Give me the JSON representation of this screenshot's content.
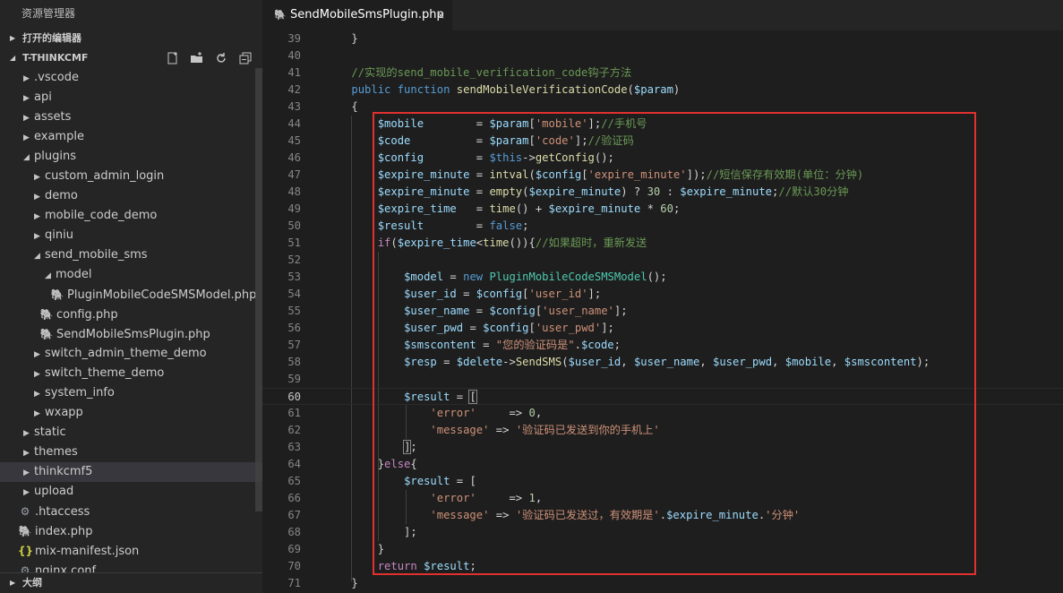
{
  "explorer": {
    "title": "资源管理器",
    "open_editors": "打开的编辑器",
    "project": "T-THINKCMF",
    "outline": "大纲",
    "tree": [
      {
        "label": ".vscode",
        "depth": 0,
        "kind": "folder",
        "expanded": false
      },
      {
        "label": "api",
        "depth": 0,
        "kind": "folder",
        "expanded": false
      },
      {
        "label": "assets",
        "depth": 0,
        "kind": "folder",
        "expanded": false
      },
      {
        "label": "example",
        "depth": 0,
        "kind": "folder",
        "expanded": false
      },
      {
        "label": "plugins",
        "depth": 0,
        "kind": "folder",
        "expanded": true
      },
      {
        "label": "custom_admin_login",
        "depth": 1,
        "kind": "folder",
        "expanded": false
      },
      {
        "label": "demo",
        "depth": 1,
        "kind": "folder",
        "expanded": false
      },
      {
        "label": "mobile_code_demo",
        "depth": 1,
        "kind": "folder",
        "expanded": false
      },
      {
        "label": "qiniu",
        "depth": 1,
        "kind": "folder",
        "expanded": false
      },
      {
        "label": "send_mobile_sms",
        "depth": 1,
        "kind": "folder",
        "expanded": true
      },
      {
        "label": "model",
        "depth": 2,
        "kind": "folder",
        "expanded": true
      },
      {
        "label": "PluginMobileCodeSMSModel.php",
        "depth": 3,
        "kind": "php"
      },
      {
        "label": "config.php",
        "depth": 2,
        "kind": "php"
      },
      {
        "label": "SendMobileSmsPlugin.php",
        "depth": 2,
        "kind": "php"
      },
      {
        "label": "switch_admin_theme_demo",
        "depth": 1,
        "kind": "folder",
        "expanded": false
      },
      {
        "label": "switch_theme_demo",
        "depth": 1,
        "kind": "folder",
        "expanded": false
      },
      {
        "label": "system_info",
        "depth": 1,
        "kind": "folder",
        "expanded": false
      },
      {
        "label": "wxapp",
        "depth": 1,
        "kind": "folder",
        "expanded": false
      },
      {
        "label": "static",
        "depth": 0,
        "kind": "folder",
        "expanded": false
      },
      {
        "label": "themes",
        "depth": 0,
        "kind": "folder",
        "expanded": false
      },
      {
        "label": "thinkcmf5",
        "depth": 0,
        "kind": "folder",
        "expanded": false,
        "selected": true
      },
      {
        "label": "upload",
        "depth": 0,
        "kind": "folder",
        "expanded": false
      },
      {
        "label": ".htaccess",
        "depth": 0,
        "kind": "gear"
      },
      {
        "label": "index.php",
        "depth": 0,
        "kind": "php"
      },
      {
        "label": "mix-manifest.json",
        "depth": 0,
        "kind": "json"
      },
      {
        "label": "nginx.conf",
        "depth": 0,
        "kind": "gear"
      }
    ]
  },
  "tab": {
    "label": "SendMobileSmsPlugin.php",
    "close": "×"
  },
  "editor": {
    "current_line": 60,
    "lines": [
      {
        "n": "39",
        "t": [
          [
            "p",
            "    }"
          ]
        ]
      },
      {
        "n": "40",
        "t": []
      },
      {
        "n": "41",
        "t": [
          [
            "p",
            "    "
          ],
          [
            "com",
            "//实现的send_mobile_verification_code钩子方法"
          ]
        ]
      },
      {
        "n": "42",
        "t": [
          [
            "p",
            "    "
          ],
          [
            "kw",
            "public function "
          ],
          [
            "fn",
            "sendMobileVerificationCode"
          ],
          [
            "p",
            "("
          ],
          [
            "var",
            "$param"
          ],
          [
            "p",
            ")"
          ]
        ]
      },
      {
        "n": "43",
        "t": [
          [
            "p",
            "    {"
          ]
        ]
      },
      {
        "n": "44",
        "t": [
          [
            "p",
            "        "
          ],
          [
            "var",
            "$mobile"
          ],
          [
            "p",
            "        = "
          ],
          [
            "var",
            "$param"
          ],
          [
            "p",
            "["
          ],
          [
            "str",
            "'mobile'"
          ],
          [
            "p",
            "];"
          ],
          [
            "com",
            "//手机号"
          ]
        ]
      },
      {
        "n": "45",
        "t": [
          [
            "p",
            "        "
          ],
          [
            "var",
            "$code"
          ],
          [
            "p",
            "          = "
          ],
          [
            "var",
            "$param"
          ],
          [
            "p",
            "["
          ],
          [
            "str",
            "'code'"
          ],
          [
            "p",
            "];"
          ],
          [
            "com",
            "//验证码"
          ]
        ]
      },
      {
        "n": "46",
        "t": [
          [
            "p",
            "        "
          ],
          [
            "var",
            "$config"
          ],
          [
            "p",
            "        = "
          ],
          [
            "kw",
            "$this"
          ],
          [
            "p",
            "->"
          ],
          [
            "fn",
            "getConfig"
          ],
          [
            "p",
            "();"
          ]
        ]
      },
      {
        "n": "47",
        "t": [
          [
            "p",
            "        "
          ],
          [
            "var",
            "$expire_minute"
          ],
          [
            "p",
            " = "
          ],
          [
            "fn",
            "intval"
          ],
          [
            "p",
            "("
          ],
          [
            "var",
            "$config"
          ],
          [
            "p",
            "["
          ],
          [
            "str",
            "'expire_minute'"
          ],
          [
            "p",
            "]);"
          ],
          [
            "com",
            "//短信保存有效期(单位：分钟)"
          ]
        ]
      },
      {
        "n": "48",
        "t": [
          [
            "p",
            "        "
          ],
          [
            "var",
            "$expire_minute"
          ],
          [
            "p",
            " = "
          ],
          [
            "fn",
            "empty"
          ],
          [
            "p",
            "("
          ],
          [
            "var",
            "$expire_minute"
          ],
          [
            "p",
            ") ? "
          ],
          [
            "num",
            "30"
          ],
          [
            "p",
            " : "
          ],
          [
            "var",
            "$expire_minute"
          ],
          [
            "p",
            ";"
          ],
          [
            "com",
            "//默认30分钟"
          ]
        ]
      },
      {
        "n": "49",
        "t": [
          [
            "p",
            "        "
          ],
          [
            "var",
            "$expire_time"
          ],
          [
            "p",
            "   = "
          ],
          [
            "fn",
            "time"
          ],
          [
            "p",
            "() + "
          ],
          [
            "var",
            "$expire_minute"
          ],
          [
            "p",
            " * "
          ],
          [
            "num",
            "60"
          ],
          [
            "p",
            ";"
          ]
        ]
      },
      {
        "n": "50",
        "t": [
          [
            "p",
            "        "
          ],
          [
            "var",
            "$result"
          ],
          [
            "p",
            "        = "
          ],
          [
            "kw",
            "false"
          ],
          [
            "p",
            ";"
          ]
        ]
      },
      {
        "n": "51",
        "t": [
          [
            "p",
            "        "
          ],
          [
            "ctl",
            "if"
          ],
          [
            "p",
            "("
          ],
          [
            "var",
            "$expire_time"
          ],
          [
            "p",
            "<"
          ],
          [
            "fn",
            "time"
          ],
          [
            "p",
            "()){"
          ],
          [
            "com",
            "//如果超时，重新发送"
          ]
        ]
      },
      {
        "n": "52",
        "t": []
      },
      {
        "n": "53",
        "t": [
          [
            "p",
            "            "
          ],
          [
            "var",
            "$model"
          ],
          [
            "p",
            " = "
          ],
          [
            "kw",
            "new "
          ],
          [
            "cls",
            "PluginMobileCodeSMSModel"
          ],
          [
            "p",
            "();"
          ]
        ]
      },
      {
        "n": "54",
        "t": [
          [
            "p",
            "            "
          ],
          [
            "var",
            "$user_id"
          ],
          [
            "p",
            " = "
          ],
          [
            "var",
            "$config"
          ],
          [
            "p",
            "["
          ],
          [
            "str",
            "'user_id'"
          ],
          [
            "p",
            "];"
          ]
        ]
      },
      {
        "n": "55",
        "t": [
          [
            "p",
            "            "
          ],
          [
            "var",
            "$user_name"
          ],
          [
            "p",
            " = "
          ],
          [
            "var",
            "$config"
          ],
          [
            "p",
            "["
          ],
          [
            "str",
            "'user_name'"
          ],
          [
            "p",
            "];"
          ]
        ]
      },
      {
        "n": "56",
        "t": [
          [
            "p",
            "            "
          ],
          [
            "var",
            "$user_pwd"
          ],
          [
            "p",
            " = "
          ],
          [
            "var",
            "$config"
          ],
          [
            "p",
            "["
          ],
          [
            "str",
            "'user_pwd'"
          ],
          [
            "p",
            "];"
          ]
        ]
      },
      {
        "n": "57",
        "t": [
          [
            "p",
            "            "
          ],
          [
            "var",
            "$smscontent"
          ],
          [
            "p",
            " = "
          ],
          [
            "str",
            "\"您的验证码是\""
          ],
          [
            "p",
            "."
          ],
          [
            "var",
            "$code"
          ],
          [
            "p",
            ";"
          ]
        ]
      },
      {
        "n": "58",
        "t": [
          [
            "p",
            "            "
          ],
          [
            "var",
            "$resp"
          ],
          [
            "p",
            " = "
          ],
          [
            "var",
            "$delete"
          ],
          [
            "p",
            "->"
          ],
          [
            "fn",
            "SendSMS"
          ],
          [
            "p",
            "("
          ],
          [
            "var",
            "$user_id"
          ],
          [
            "p",
            ", "
          ],
          [
            "var",
            "$user_name"
          ],
          [
            "p",
            ", "
          ],
          [
            "var",
            "$user_pwd"
          ],
          [
            "p",
            ", "
          ],
          [
            "var",
            "$mobile"
          ],
          [
            "p",
            ", "
          ],
          [
            "var",
            "$smscontent"
          ],
          [
            "p",
            ");"
          ]
        ]
      },
      {
        "n": "59",
        "t": []
      },
      {
        "n": "60",
        "t": [
          [
            "p",
            "            "
          ],
          [
            "var",
            "$result"
          ],
          [
            "p",
            " = "
          ],
          [
            "bkt",
            "["
          ]
        ]
      },
      {
        "n": "61",
        "t": [
          [
            "p",
            "                "
          ],
          [
            "str",
            "'error'"
          ],
          [
            "p",
            "     => "
          ],
          [
            "num",
            "0"
          ],
          [
            "p",
            ","
          ]
        ]
      },
      {
        "n": "62",
        "t": [
          [
            "p",
            "                "
          ],
          [
            "str",
            "'message'"
          ],
          [
            "p",
            " => "
          ],
          [
            "str",
            "'验证码已发送到你的手机上'"
          ]
        ]
      },
      {
        "n": "63",
        "t": [
          [
            "p",
            "            "
          ],
          [
            "bkt",
            "]"
          ],
          [
            "p",
            ";"
          ]
        ]
      },
      {
        "n": "64",
        "t": [
          [
            "p",
            "        }"
          ],
          [
            "ctl",
            "else"
          ],
          [
            "p",
            "{"
          ]
        ]
      },
      {
        "n": "65",
        "t": [
          [
            "p",
            "            "
          ],
          [
            "var",
            "$result"
          ],
          [
            "p",
            " = ["
          ]
        ]
      },
      {
        "n": "66",
        "t": [
          [
            "p",
            "                "
          ],
          [
            "str",
            "'error'"
          ],
          [
            "p",
            "     => "
          ],
          [
            "num",
            "1"
          ],
          [
            "p",
            ","
          ]
        ]
      },
      {
        "n": "67",
        "t": [
          [
            "p",
            "                "
          ],
          [
            "str",
            "'message'"
          ],
          [
            "p",
            " => "
          ],
          [
            "str",
            "'验证码已发送过，有效期是'"
          ],
          [
            "p",
            "."
          ],
          [
            "var",
            "$expire_minute"
          ],
          [
            "p",
            "."
          ],
          [
            "str",
            "'分钟'"
          ]
        ]
      },
      {
        "n": "68",
        "t": [
          [
            "p",
            "            ];"
          ]
        ]
      },
      {
        "n": "69",
        "t": [
          [
            "p",
            "        }"
          ]
        ]
      },
      {
        "n": "70",
        "t": [
          [
            "p",
            "        "
          ],
          [
            "ctl",
            "return "
          ],
          [
            "var",
            "$result"
          ],
          [
            "p",
            ";"
          ]
        ]
      },
      {
        "n": "71",
        "t": [
          [
            "p",
            "    }"
          ]
        ]
      }
    ]
  },
  "colors": {
    "highlight_box": "#e0312f",
    "php_icon": "#a074c4"
  }
}
